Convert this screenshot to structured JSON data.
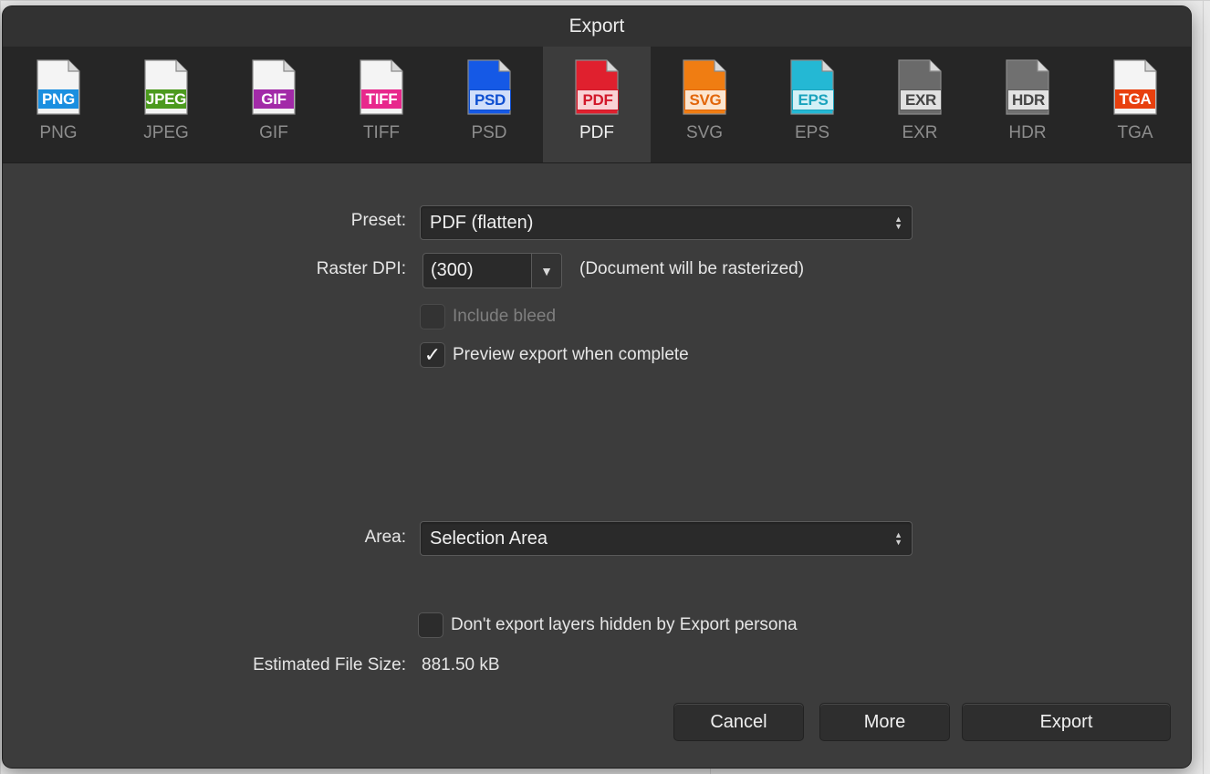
{
  "dialog": {
    "title": "Export"
  },
  "formats": [
    {
      "name": "PNG",
      "badge": "PNG",
      "color": "#1a8fe0",
      "paper": "#f4f4f4",
      "active": false
    },
    {
      "name": "JPEG",
      "badge": "JPEG",
      "color": "#4c9a1e",
      "paper": "#f4f4f4",
      "active": false
    },
    {
      "name": "GIF",
      "badge": "GIF",
      "color": "#a22aa8",
      "paper": "#f4f4f4",
      "active": false
    },
    {
      "name": "TIFF",
      "badge": "TIFF",
      "color": "#e8288c",
      "paper": "#f4f4f4",
      "active": false
    },
    {
      "name": "PSD",
      "badge": "PSD",
      "color": "#0e4fd1",
      "paper": "#1559e6",
      "active": false
    },
    {
      "name": "PDF",
      "badge": "PDF",
      "color": "#d2182a",
      "paper": "#e0202e",
      "active": true
    },
    {
      "name": "SVG",
      "badge": "SVG",
      "color": "#e2660a",
      "paper": "#f07d12",
      "active": false
    },
    {
      "name": "EPS",
      "badge": "EPS",
      "color": "#1aa3bd",
      "paper": "#24b8d4",
      "active": false
    },
    {
      "name": "EXR",
      "badge": "EXR",
      "color": "#5a5a5a",
      "paper": "#6a6a6a",
      "active": false
    },
    {
      "name": "HDR",
      "badge": "HDR",
      "color": "#5f5f5f",
      "paper": "#707070",
      "active": false
    },
    {
      "name": "TGA",
      "badge": "TGA",
      "color": "#e8400e",
      "paper": "#f4f4f4",
      "active": false
    }
  ],
  "preset": {
    "label": "Preset:",
    "value": "PDF (flatten)"
  },
  "raster_dpi": {
    "label": "Raster DPI:",
    "value": "(300)",
    "note": "(Document will be rasterized)"
  },
  "include_bleed": {
    "label": "Include bleed",
    "checked": false,
    "enabled": false
  },
  "preview_export": {
    "label": "Preview export when complete",
    "checked": true,
    "check_glyph": "✓"
  },
  "area": {
    "label": "Area:",
    "value": "Selection Area"
  },
  "hidden_layers": {
    "label": "Don't export layers hidden by Export persona",
    "checked": false
  },
  "file_size": {
    "label": "Estimated File Size:",
    "value": "881.50 kB"
  },
  "buttons": {
    "cancel": "Cancel",
    "more": "More",
    "export": "Export"
  },
  "icons": {
    "updown": "▲▼",
    "dropdown_arrow": "▼"
  }
}
